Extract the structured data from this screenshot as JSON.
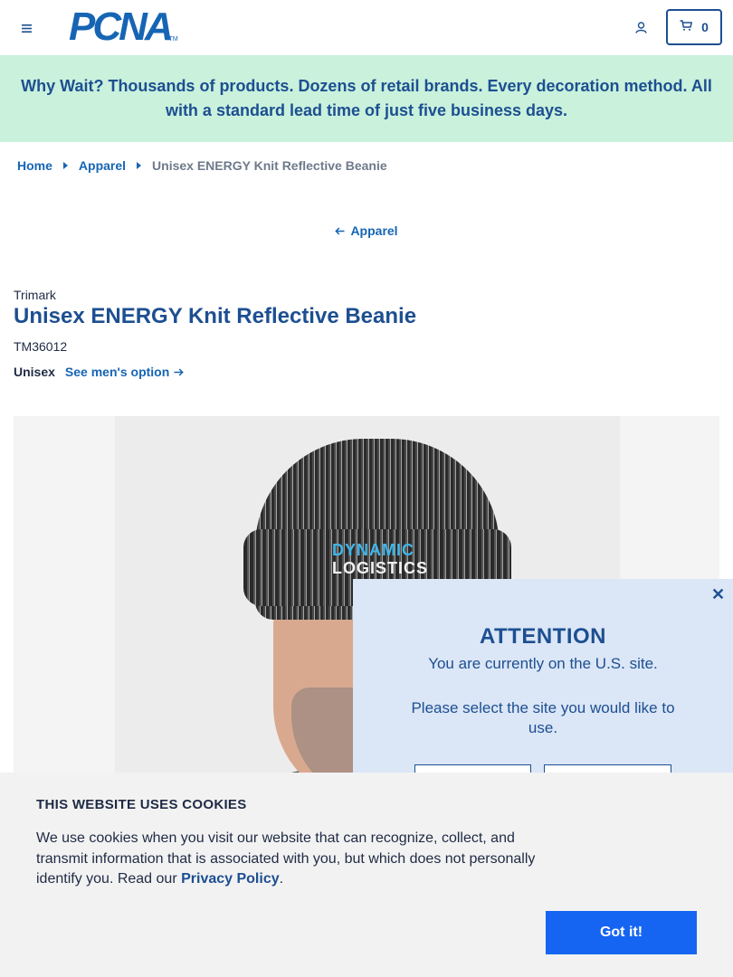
{
  "header": {
    "logo_text": "PCNA",
    "logo_tm": "TM",
    "cart_count": "0",
    "icons": {
      "menu": "hamburger-menu-icon",
      "account": "user-account-icon",
      "cart": "shopping-cart-icon"
    }
  },
  "banner": {
    "text": "Why Wait? Thousands of products. Dozens of retail brands. Every decoration method. All with a standard lead time of just five business days.",
    "background": "#c9f1dc"
  },
  "breadcrumb": {
    "items": [
      "Home",
      "Apparel"
    ],
    "current": "Unisex ENERGY Knit Reflective Beanie"
  },
  "back_link": {
    "label": "Apparel"
  },
  "product": {
    "brand": "Trimark",
    "title": "Unisex ENERGY Knit Reflective Beanie",
    "sku": "TM36012",
    "gender": "Unisex",
    "alt_link": "See men's option",
    "image_logo_line1": "DYNAMIC",
    "image_logo_line2": "LOGISTICS"
  },
  "attention_modal": {
    "title": "ATTENTION",
    "message": "You are currently on the U.S. site.",
    "prompt": "Please select the site you would like to use."
  },
  "cookie_banner": {
    "title": "THIS WEBSITE USES COOKIES",
    "text_before": "We use cookies when you visit our website that can recognize, collect, and transmit information that is associated with you, but which does not personally identify you. Read our ",
    "link_label": "Privacy Policy",
    "text_after": ".",
    "button_label": "Got it!"
  },
  "colors": {
    "primary": "#1d4f91",
    "link": "#1665b4",
    "cookie_button": "#1665f2",
    "modal_bg": "#dbe6f6"
  }
}
